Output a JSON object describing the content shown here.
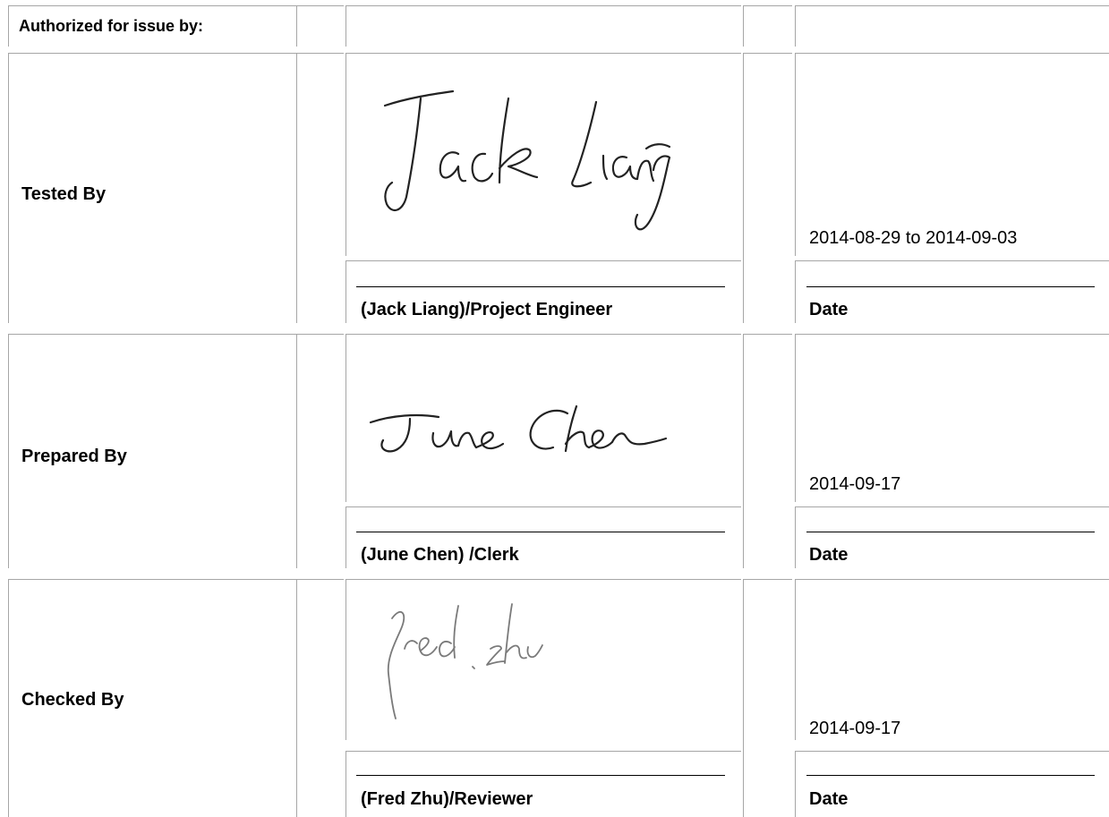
{
  "header": {
    "label": "Authorized for issue by:"
  },
  "rows": [
    {
      "role": "Tested By",
      "signer": "(Jack Liang)/Project Engineer",
      "date_value": "2014-08-29 to 2014-09-03",
      "date_label": "Date",
      "signature_text": "Jack Liang"
    },
    {
      "role": "Prepared By",
      "signer": "(June Chen) /Clerk",
      "date_value": "2014-09-17",
      "date_label": "Date",
      "signature_text": "June Chen"
    },
    {
      "role": "Checked By",
      "signer": "(Fred Zhu)/Reviewer",
      "date_value": "2014-09-17",
      "date_label": "Date",
      "signature_text": "Fred Zhu"
    }
  ]
}
